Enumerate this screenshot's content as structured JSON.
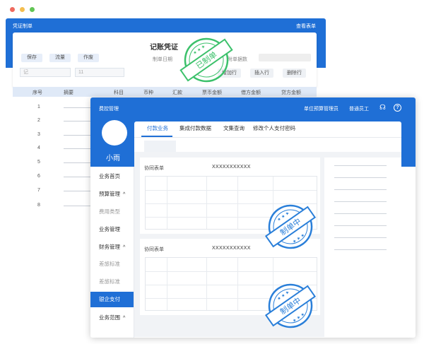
{
  "colors": {
    "brand_blue": "#1f6fd6",
    "stamp_green": "#3cc16b",
    "stamp_blue": "#2a7fd9",
    "dot_red": "#ef6a5e",
    "dot_yellow": "#f4be4f",
    "dot_green": "#62c554"
  },
  "voucher": {
    "window_title": "凭证制单",
    "view_link": "查看表单",
    "title": "记账凭证",
    "buttons": [
      "保存",
      "流量",
      "作废"
    ],
    "date_label": "制单日期",
    "attachment_label": "附单据数",
    "input1": "记",
    "input2": "11",
    "actions": [
      "增加行",
      "插入行",
      "删除行"
    ],
    "columns": [
      "序号",
      "摘要",
      "科目",
      "币种",
      "汇款",
      "票币金额",
      "借方金额",
      "贷方金额"
    ],
    "row_numbers": [
      "1",
      "2",
      "3",
      "4",
      "5",
      "6",
      "7",
      "8"
    ],
    "stamp_text": "已制单"
  },
  "front": {
    "window_title": "费控管理",
    "org_name": "单位预算管理员",
    "role": "普通员工",
    "headset_icon": "headset-icon",
    "help_icon": "help-icon",
    "username": "小雨",
    "sidebar": [
      {
        "label": "业务首页",
        "sub": false,
        "caret": "",
        "active": false
      },
      {
        "label": "预算管理",
        "sub": false,
        "caret": "^",
        "active": false
      },
      {
        "label": "费用类型",
        "sub": true,
        "caret": "",
        "active": false
      },
      {
        "label": "业务管理",
        "sub": false,
        "caret": "",
        "active": false
      },
      {
        "label": "财务管理",
        "sub": false,
        "caret": "^",
        "active": false
      },
      {
        "label": "差旅标准",
        "sub": true,
        "caret": "",
        "active": false
      },
      {
        "label": "差旅标准",
        "sub": true,
        "caret": "",
        "active": false
      },
      {
        "label": "银企支付",
        "sub": false,
        "caret": "",
        "active": true
      },
      {
        "label": "业务范围",
        "sub": false,
        "caret": "^",
        "active": false
      }
    ],
    "tabs": [
      "付款业务",
      "集成付款数据",
      "文集查询",
      "修改个人支付密码"
    ],
    "panels": [
      {
        "label": "协同表单",
        "value": "XXXXXXXXXXX"
      },
      {
        "label": "协同表单",
        "value": "XXXXXXXXXXX"
      }
    ],
    "stamp_text": "制单中"
  }
}
